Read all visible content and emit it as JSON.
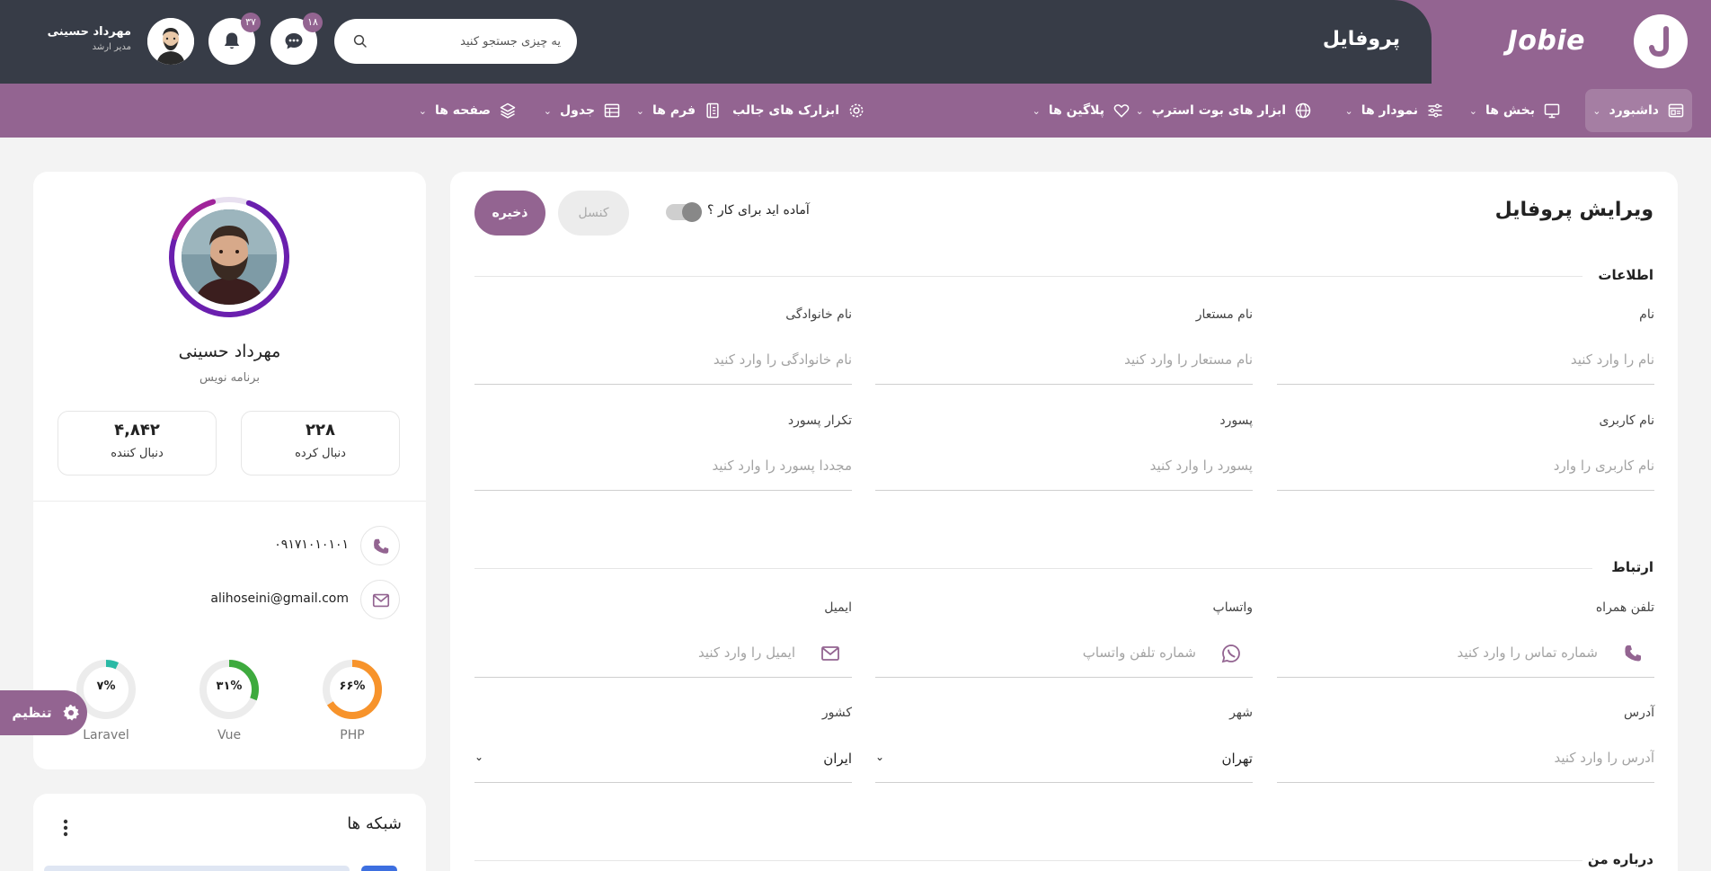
{
  "header": {
    "brand_name": "Jobie",
    "page_title": "پروفایل",
    "search_placeholder": "یه چیزی جستجو کنید",
    "messages_badge": "۱۸",
    "notifications_badge": "۳۷",
    "user_name": "مهرداد حسینی",
    "user_role": "مدیر ارشد"
  },
  "nav": {
    "items": [
      {
        "label": "داشبورد",
        "icon": "dashboard-icon",
        "active": true
      },
      {
        "label": "بخش ها",
        "icon": "monitor-icon"
      },
      {
        "label": "نمودار ها",
        "icon": "sliders-icon"
      },
      {
        "label": "ابزار های بوت استرپ",
        "icon": "globe-icon"
      },
      {
        "label": "پلاگین ها",
        "icon": "heart-icon"
      },
      {
        "label": "ابزارک های جالب",
        "icon": "gear-icon"
      },
      {
        "label": "فرم ها",
        "icon": "clipboard-icon"
      },
      {
        "label": "جدول",
        "icon": "table-icon"
      },
      {
        "label": "صفحه ها",
        "icon": "layers-icon"
      }
    ]
  },
  "profile": {
    "name": "مهرداد حسینی",
    "title": "برنامه نویس",
    "following_value": "۲۲۸",
    "following_label": "دنبال کرده",
    "followers_value": "۴,۸۴۲",
    "followers_label": "دنبال کننده",
    "phone": "۰۹۱۷۱۰۱۰۱۰۱",
    "email": "alihoseini@gmail.com",
    "skills": [
      {
        "label": "PHP",
        "percent": 66,
        "percent_text": "۶۶%",
        "color": "#f7932b"
      },
      {
        "label": "Vue",
        "percent": 31,
        "percent_text": "۳۱%",
        "color": "#3eaa3e"
      },
      {
        "label": "Laravel",
        "percent": 7,
        "percent_text": "۷%",
        "color": "#2ab9a5"
      }
    ],
    "settings_label": "تنظیم"
  },
  "network": {
    "title": "شبکه ها"
  },
  "form": {
    "title": "ویرایش پروفایل",
    "ready_label": "آماده اید برای کار ؟",
    "cancel_label": "کنسل",
    "save_label": "ذخیره",
    "info_section": "اطلاعات",
    "first_name_label": "نام",
    "first_name_placeholder": "نام را وارد کنید",
    "alias_label": "نام مستعار",
    "alias_placeholder": "نام مستعار را وارد کنید",
    "last_name_label": "نام خانوادگی",
    "last_name_placeholder": "نام خانوادگی را وارد کنید",
    "username_label": "نام کاربری",
    "username_placeholder": "نام کاربری را وارد",
    "password_label": "پسورد",
    "password_placeholder": "پسورد را وارد کنید",
    "password_repeat_label": "تکرار پسورد",
    "password_repeat_placeholder": "مجددا پسورد را وارد کنید",
    "contact_section": "ارتباط",
    "mobile_label": "تلفن همراه",
    "mobile_placeholder": "شماره تماس را وارد کنید",
    "whatsapp_label": "واتساپ",
    "whatsapp_placeholder": "شماره تلفن واتساپ",
    "email_label": "ایمیل",
    "email_placeholder": "ایمیل را وارد کنید",
    "address_label": "آدرس",
    "address_placeholder": "آدرس را وارد کنید",
    "city_label": "شهر",
    "city_value": "تهران",
    "country_label": "کشور",
    "country_value": "ایران",
    "about_section": "درباره من"
  },
  "colors": {
    "accent": "#936491",
    "header_dark": "#373c47"
  }
}
